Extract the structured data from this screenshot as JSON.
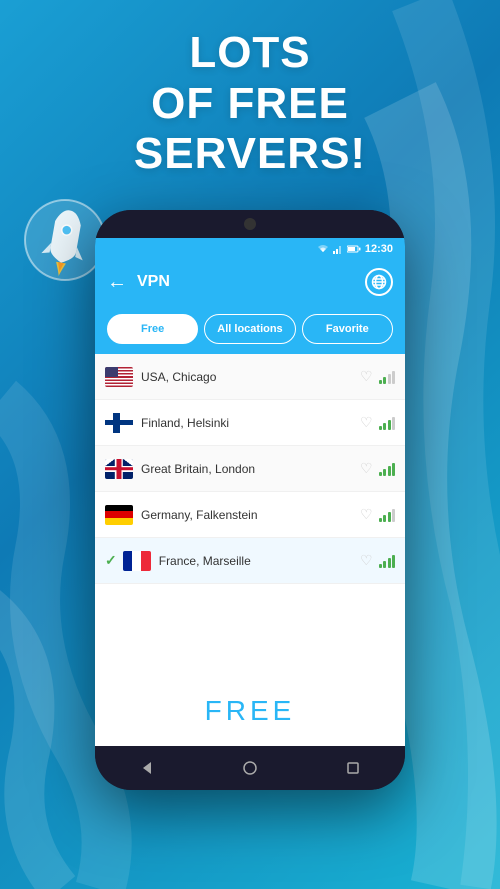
{
  "background": {
    "gradient_start": "#1a9fd4",
    "gradient_end": "#0e7ab5"
  },
  "headline": {
    "line1": "Lots",
    "line2": "of free",
    "line3": "servers!"
  },
  "phone": {
    "status_bar": {
      "time": "12:30"
    },
    "header": {
      "title": "VPN",
      "back_label": "←"
    },
    "tabs": [
      {
        "id": "free",
        "label": "Free",
        "active": true
      },
      {
        "id": "all",
        "label": "All locations",
        "active": false
      },
      {
        "id": "fav",
        "label": "Favorite",
        "active": false
      }
    ],
    "servers": [
      {
        "id": 1,
        "country": "USA",
        "city": "Chicago",
        "selected": false,
        "connected": false
      },
      {
        "id": 2,
        "country": "Finland",
        "city": "Helsinki",
        "selected": false,
        "connected": false
      },
      {
        "id": 3,
        "country": "Great Britain",
        "city": "London",
        "selected": false,
        "connected": false
      },
      {
        "id": 4,
        "country": "Germany",
        "city": "Falkenstein",
        "selected": false,
        "connected": false
      },
      {
        "id": 5,
        "country": "France",
        "city": "Marseille",
        "selected": true,
        "connected": true
      }
    ],
    "free_label": "FREE",
    "nav": {
      "back": "◁",
      "home": "○",
      "square": "□"
    }
  }
}
